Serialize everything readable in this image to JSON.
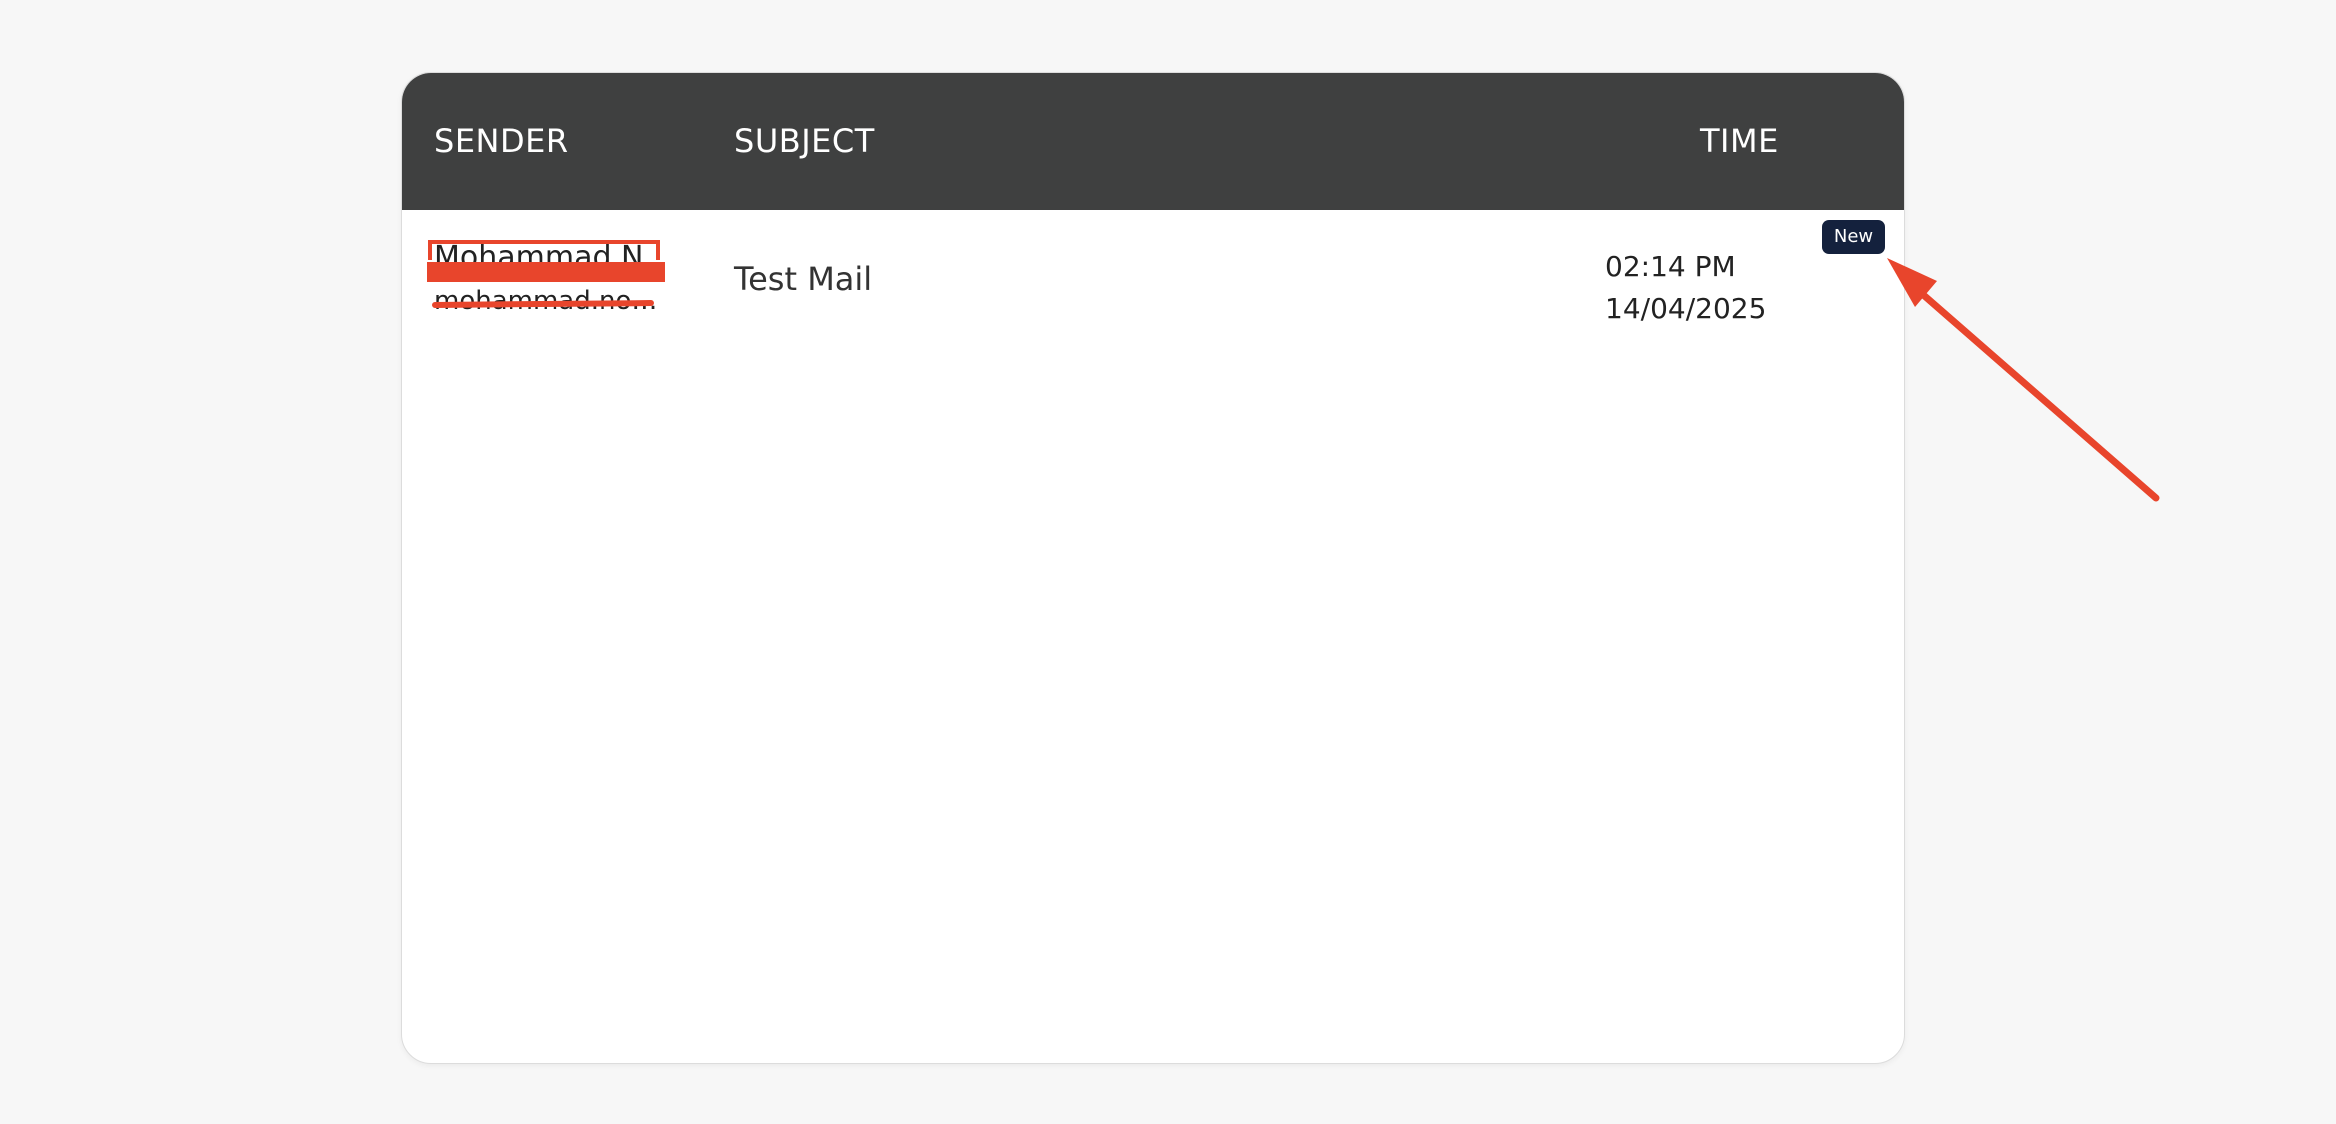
{
  "table": {
    "headers": {
      "sender": "SENDER",
      "subject": "SUBJECT",
      "time": "TIME"
    }
  },
  "rows": [
    {
      "sender_name": "Mohammad N",
      "sender_email": "mohammad.nou...",
      "subject": "Test Mail",
      "time": "02:14 PM",
      "date": "14/04/2025",
      "badge": "New"
    }
  ],
  "colors": {
    "header_bg": "#3f4040",
    "badge_bg": "#14213d",
    "annotation": "#e8452c",
    "page_bg": "#f7f7f7"
  }
}
